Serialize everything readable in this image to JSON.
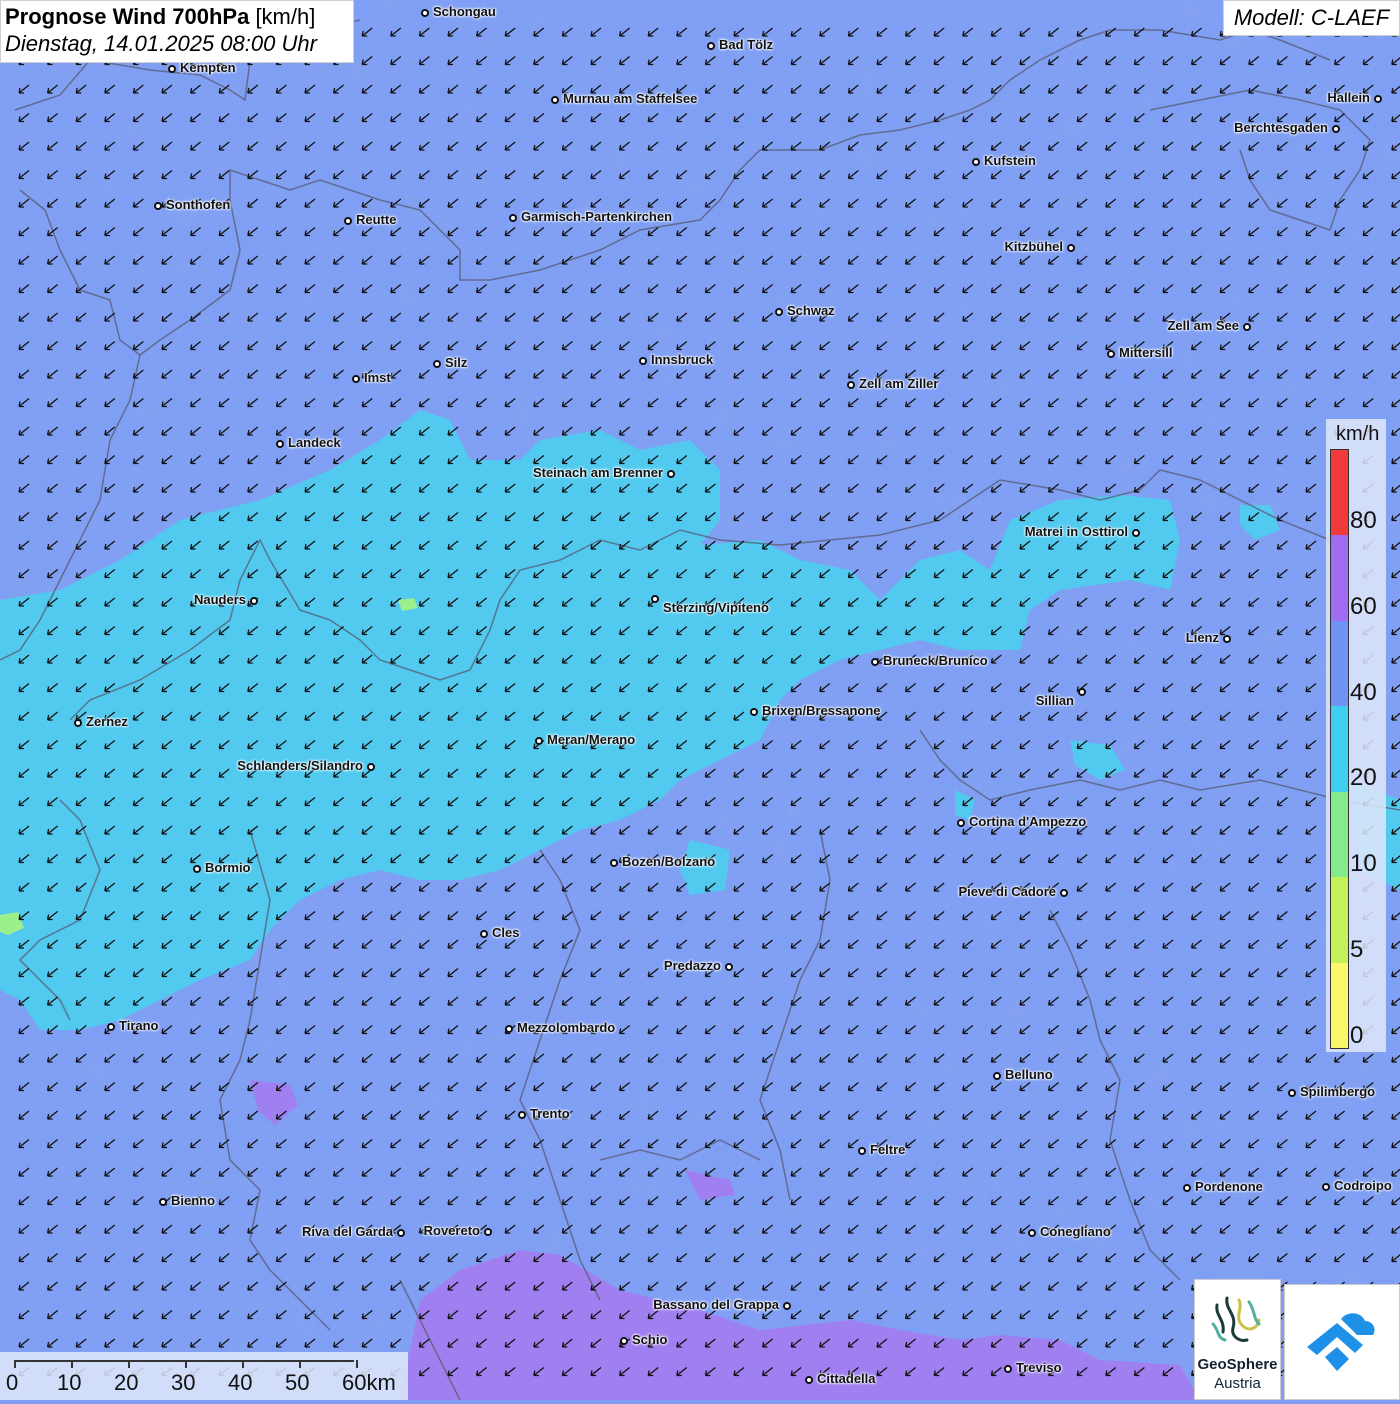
{
  "header": {
    "title_bold": "Prognose Wind 700hPa",
    "title_unit": "[km/h]",
    "datetime": "Dienstag, 14.01.2025 08:00 Uhr"
  },
  "model": {
    "label": "Modell: C-LAEF"
  },
  "colors": {
    "base_20_40": "#7f9ff5",
    "cyan_20": "#45d6ee",
    "purple_60": "#a37cf0",
    "green_10": "#9cf08c"
  },
  "cities": [
    {
      "name": "Schongau"
    },
    {
      "name": "Bad Tölz"
    },
    {
      "name": "Kempten"
    },
    {
      "name": "Murnau am Staffelsee"
    },
    {
      "name": "Hallein"
    },
    {
      "name": "Berchtesgaden"
    },
    {
      "name": "Kufstein"
    },
    {
      "name": "Sonthofen"
    },
    {
      "name": "Reutte"
    },
    {
      "name": "Garmisch-Partenkirchen"
    },
    {
      "name": "Kitzbühel"
    },
    {
      "name": "Schwaz"
    },
    {
      "name": "Zell am See"
    },
    {
      "name": "Mittersill"
    },
    {
      "name": "Innsbruck"
    },
    {
      "name": "Silz"
    },
    {
      "name": "Imst"
    },
    {
      "name": "Zell am Ziller"
    },
    {
      "name": "Landeck"
    },
    {
      "name": "Steinach am Brenner"
    },
    {
      "name": "Matrei in Osttirol"
    },
    {
      "name": "Nauders"
    },
    {
      "name": "Sterzing/Vipiteno"
    },
    {
      "name": "Lienz"
    },
    {
      "name": "Bruneck/Brunico"
    },
    {
      "name": "Sillian"
    },
    {
      "name": "Zernez"
    },
    {
      "name": "Brixen/Bressanone"
    },
    {
      "name": "Meran/Merano"
    },
    {
      "name": "Schlanders/Silandro"
    },
    {
      "name": "Cortina d'Ampezzo"
    },
    {
      "name": "Bozen/Bolzano"
    },
    {
      "name": "Bormio"
    },
    {
      "name": "Pieve di Cadore"
    },
    {
      "name": "Cles"
    },
    {
      "name": "Predazzo"
    },
    {
      "name": "Tirano"
    },
    {
      "name": "Mezzolombardo"
    },
    {
      "name": "Belluno"
    },
    {
      "name": "Spilimbergo"
    },
    {
      "name": "Trento"
    },
    {
      "name": "Feltre"
    },
    {
      "name": "Pordenone"
    },
    {
      "name": "Codroipo"
    },
    {
      "name": "Bienno"
    },
    {
      "name": "Riva del Garda"
    },
    {
      "name": "Rovereto"
    },
    {
      "name": "Conegliano"
    },
    {
      "name": "Bassano del Grappa"
    },
    {
      "name": "Schio"
    },
    {
      "name": "Treviso"
    },
    {
      "name": "Cittadella"
    }
  ],
  "legend": {
    "unit": "km/h",
    "labels": [
      "80",
      "60",
      "40",
      "20",
      "10",
      "5",
      "0"
    ],
    "segments": [
      {
        "color": "#f23a3a"
      },
      {
        "color": "#9f6cf2"
      },
      {
        "color": "#6f94f5"
      },
      {
        "color": "#3fcff0"
      },
      {
        "color": "#85ea8a"
      },
      {
        "color": "#c4f05a"
      },
      {
        "color": "#f8f86a"
      }
    ]
  },
  "scale": {
    "labels": [
      "0",
      "10",
      "20",
      "30",
      "40",
      "50",
      "60km"
    ]
  },
  "logos": {
    "geosphere_line1": "GeoSphere",
    "geosphere_line2": "Austria"
  }
}
